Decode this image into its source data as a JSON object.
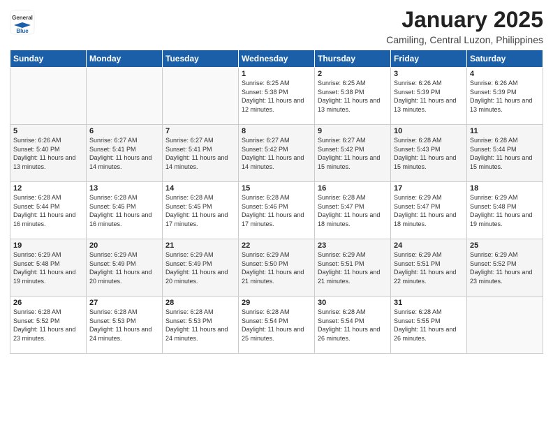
{
  "logo": {
    "general": "General",
    "blue": "Blue"
  },
  "title": "January 2025",
  "location": "Camiling, Central Luzon, Philippines",
  "days_header": [
    "Sunday",
    "Monday",
    "Tuesday",
    "Wednesday",
    "Thursday",
    "Friday",
    "Saturday"
  ],
  "weeks": [
    [
      {
        "day": "",
        "sunrise": "",
        "sunset": "",
        "daylight": ""
      },
      {
        "day": "",
        "sunrise": "",
        "sunset": "",
        "daylight": ""
      },
      {
        "day": "",
        "sunrise": "",
        "sunset": "",
        "daylight": ""
      },
      {
        "day": "1",
        "sunrise": "Sunrise: 6:25 AM",
        "sunset": "Sunset: 5:38 PM",
        "daylight": "Daylight: 11 hours and 12 minutes."
      },
      {
        "day": "2",
        "sunrise": "Sunrise: 6:25 AM",
        "sunset": "Sunset: 5:38 PM",
        "daylight": "Daylight: 11 hours and 13 minutes."
      },
      {
        "day": "3",
        "sunrise": "Sunrise: 6:26 AM",
        "sunset": "Sunset: 5:39 PM",
        "daylight": "Daylight: 11 hours and 13 minutes."
      },
      {
        "day": "4",
        "sunrise": "Sunrise: 6:26 AM",
        "sunset": "Sunset: 5:39 PM",
        "daylight": "Daylight: 11 hours and 13 minutes."
      }
    ],
    [
      {
        "day": "5",
        "sunrise": "Sunrise: 6:26 AM",
        "sunset": "Sunset: 5:40 PM",
        "daylight": "Daylight: 11 hours and 13 minutes."
      },
      {
        "day": "6",
        "sunrise": "Sunrise: 6:27 AM",
        "sunset": "Sunset: 5:41 PM",
        "daylight": "Daylight: 11 hours and 14 minutes."
      },
      {
        "day": "7",
        "sunrise": "Sunrise: 6:27 AM",
        "sunset": "Sunset: 5:41 PM",
        "daylight": "Daylight: 11 hours and 14 minutes."
      },
      {
        "day": "8",
        "sunrise": "Sunrise: 6:27 AM",
        "sunset": "Sunset: 5:42 PM",
        "daylight": "Daylight: 11 hours and 14 minutes."
      },
      {
        "day": "9",
        "sunrise": "Sunrise: 6:27 AM",
        "sunset": "Sunset: 5:42 PM",
        "daylight": "Daylight: 11 hours and 15 minutes."
      },
      {
        "day": "10",
        "sunrise": "Sunrise: 6:28 AM",
        "sunset": "Sunset: 5:43 PM",
        "daylight": "Daylight: 11 hours and 15 minutes."
      },
      {
        "day": "11",
        "sunrise": "Sunrise: 6:28 AM",
        "sunset": "Sunset: 5:44 PM",
        "daylight": "Daylight: 11 hours and 15 minutes."
      }
    ],
    [
      {
        "day": "12",
        "sunrise": "Sunrise: 6:28 AM",
        "sunset": "Sunset: 5:44 PM",
        "daylight": "Daylight: 11 hours and 16 minutes."
      },
      {
        "day": "13",
        "sunrise": "Sunrise: 6:28 AM",
        "sunset": "Sunset: 5:45 PM",
        "daylight": "Daylight: 11 hours and 16 minutes."
      },
      {
        "day": "14",
        "sunrise": "Sunrise: 6:28 AM",
        "sunset": "Sunset: 5:45 PM",
        "daylight": "Daylight: 11 hours and 17 minutes."
      },
      {
        "day": "15",
        "sunrise": "Sunrise: 6:28 AM",
        "sunset": "Sunset: 5:46 PM",
        "daylight": "Daylight: 11 hours and 17 minutes."
      },
      {
        "day": "16",
        "sunrise": "Sunrise: 6:28 AM",
        "sunset": "Sunset: 5:47 PM",
        "daylight": "Daylight: 11 hours and 18 minutes."
      },
      {
        "day": "17",
        "sunrise": "Sunrise: 6:29 AM",
        "sunset": "Sunset: 5:47 PM",
        "daylight": "Daylight: 11 hours and 18 minutes."
      },
      {
        "day": "18",
        "sunrise": "Sunrise: 6:29 AM",
        "sunset": "Sunset: 5:48 PM",
        "daylight": "Daylight: 11 hours and 19 minutes."
      }
    ],
    [
      {
        "day": "19",
        "sunrise": "Sunrise: 6:29 AM",
        "sunset": "Sunset: 5:48 PM",
        "daylight": "Daylight: 11 hours and 19 minutes."
      },
      {
        "day": "20",
        "sunrise": "Sunrise: 6:29 AM",
        "sunset": "Sunset: 5:49 PM",
        "daylight": "Daylight: 11 hours and 20 minutes."
      },
      {
        "day": "21",
        "sunrise": "Sunrise: 6:29 AM",
        "sunset": "Sunset: 5:49 PM",
        "daylight": "Daylight: 11 hours and 20 minutes."
      },
      {
        "day": "22",
        "sunrise": "Sunrise: 6:29 AM",
        "sunset": "Sunset: 5:50 PM",
        "daylight": "Daylight: 11 hours and 21 minutes."
      },
      {
        "day": "23",
        "sunrise": "Sunrise: 6:29 AM",
        "sunset": "Sunset: 5:51 PM",
        "daylight": "Daylight: 11 hours and 21 minutes."
      },
      {
        "day": "24",
        "sunrise": "Sunrise: 6:29 AM",
        "sunset": "Sunset: 5:51 PM",
        "daylight": "Daylight: 11 hours and 22 minutes."
      },
      {
        "day": "25",
        "sunrise": "Sunrise: 6:29 AM",
        "sunset": "Sunset: 5:52 PM",
        "daylight": "Daylight: 11 hours and 23 minutes."
      }
    ],
    [
      {
        "day": "26",
        "sunrise": "Sunrise: 6:28 AM",
        "sunset": "Sunset: 5:52 PM",
        "daylight": "Daylight: 11 hours and 23 minutes."
      },
      {
        "day": "27",
        "sunrise": "Sunrise: 6:28 AM",
        "sunset": "Sunset: 5:53 PM",
        "daylight": "Daylight: 11 hours and 24 minutes."
      },
      {
        "day": "28",
        "sunrise": "Sunrise: 6:28 AM",
        "sunset": "Sunset: 5:53 PM",
        "daylight": "Daylight: 11 hours and 24 minutes."
      },
      {
        "day": "29",
        "sunrise": "Sunrise: 6:28 AM",
        "sunset": "Sunset: 5:54 PM",
        "daylight": "Daylight: 11 hours and 25 minutes."
      },
      {
        "day": "30",
        "sunrise": "Sunrise: 6:28 AM",
        "sunset": "Sunset: 5:54 PM",
        "daylight": "Daylight: 11 hours and 26 minutes."
      },
      {
        "day": "31",
        "sunrise": "Sunrise: 6:28 AM",
        "sunset": "Sunset: 5:55 PM",
        "daylight": "Daylight: 11 hours and 26 minutes."
      },
      {
        "day": "",
        "sunrise": "",
        "sunset": "",
        "daylight": ""
      }
    ]
  ]
}
